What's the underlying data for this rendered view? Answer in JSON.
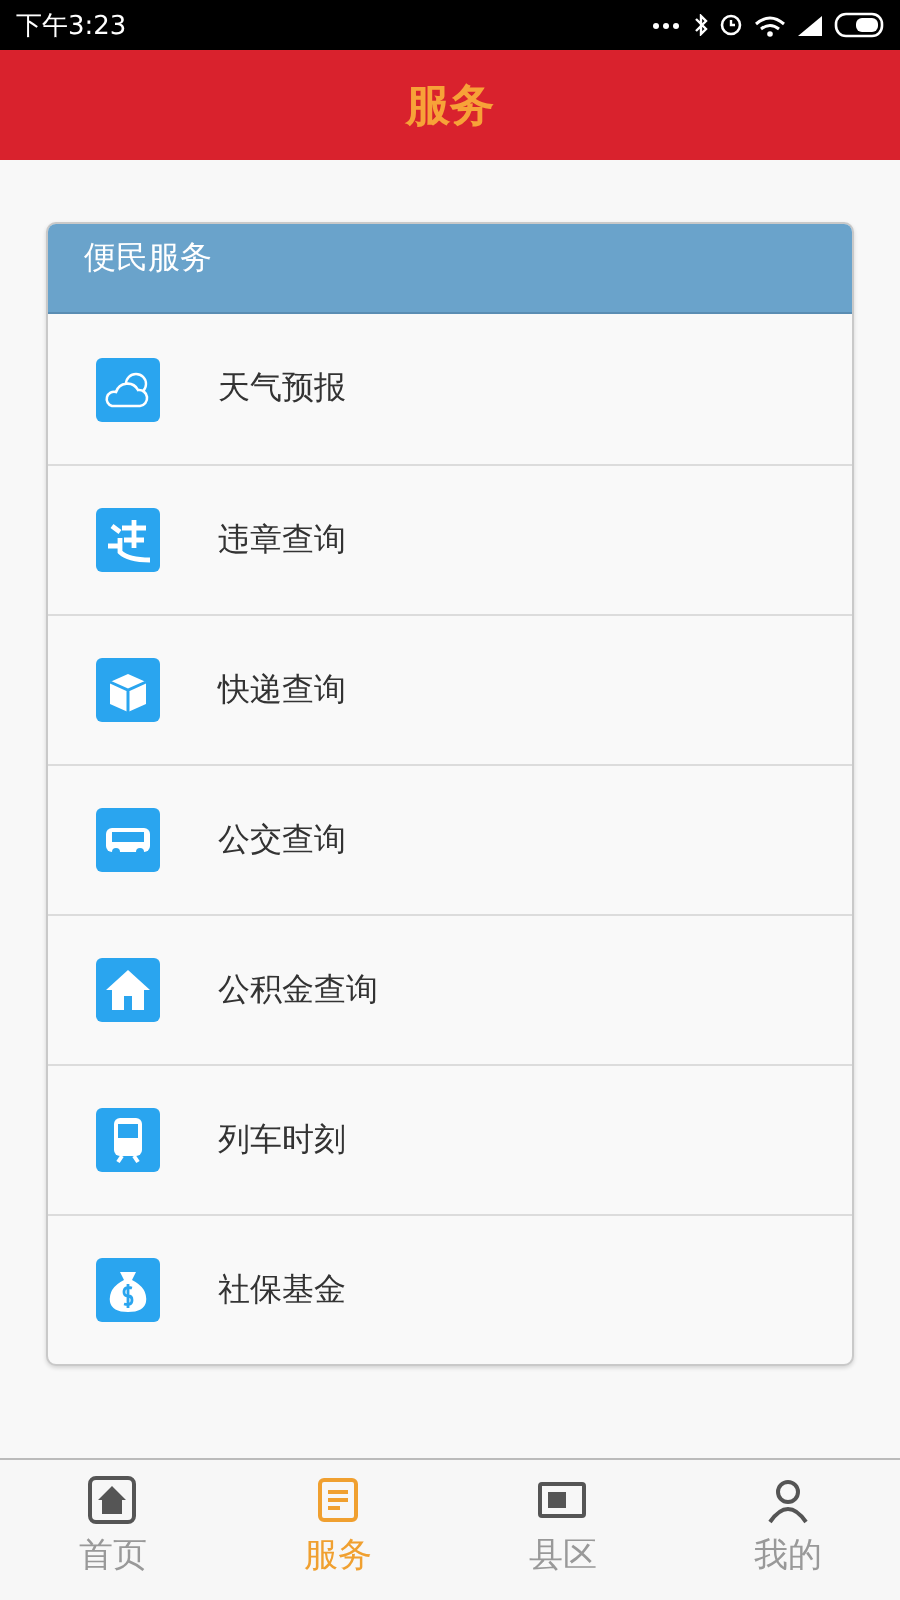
{
  "status_bar": {
    "time": "下午3:23"
  },
  "header": {
    "title": "服务"
  },
  "section": {
    "title": "便民服务",
    "items": [
      {
        "label": "天气预报",
        "kind": "weather"
      },
      {
        "label": "违章查询",
        "kind": "traffic"
      },
      {
        "label": "快递查询",
        "kind": "parcel"
      },
      {
        "label": "公交查询",
        "kind": "bus"
      },
      {
        "label": "公积金查询",
        "kind": "house"
      },
      {
        "label": "列车时刻",
        "kind": "train"
      },
      {
        "label": "社保基金",
        "kind": "money"
      }
    ]
  },
  "tabs": [
    {
      "label": "首页",
      "kind": "home",
      "selected": false
    },
    {
      "label": "服务",
      "kind": "service",
      "selected": true
    },
    {
      "label": "县区",
      "kind": "region",
      "selected": false
    },
    {
      "label": "我的",
      "kind": "user",
      "selected": false
    }
  ]
}
